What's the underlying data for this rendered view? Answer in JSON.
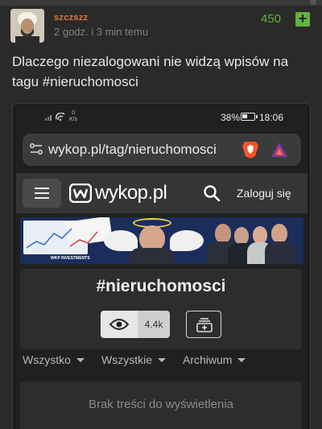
{
  "post": {
    "username": "szczszz",
    "time": "2 godz. i 3 min temu",
    "votes": "450",
    "vote_button": "+",
    "text": "Dlaczego niezalogowani nie widzą wpisów na tagu #nieruchomosci"
  },
  "embedded_screenshot": {
    "status_bar": {
      "network_speed_value": "0",
      "network_speed_unit": "K/s",
      "battery_percent": "38%",
      "time": "18:06"
    },
    "address_bar": {
      "url": "wykop.pl/tag/nieruchomosci"
    },
    "site_header": {
      "logo_text": "wykop.pl",
      "login_label": "Zaloguj się"
    },
    "banner": {
      "brand_text": "WKP INVESTMENTS"
    },
    "tag_card": {
      "title": "#nieruchomosci",
      "observers_count": "4.4k"
    },
    "filters": [
      {
        "label": "Wszystko"
      },
      {
        "label": "Wszystkie"
      },
      {
        "label": "Archiwum"
      }
    ],
    "empty_message": "Brak treści do wyświetlenia"
  },
  "colors": {
    "username": "#e4753b",
    "votes": "#5fb340",
    "background": "#2a2a2a"
  }
}
